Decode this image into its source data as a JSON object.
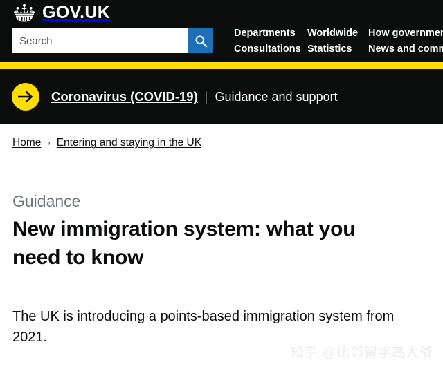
{
  "header": {
    "crown_icon": "royal-crown-icon",
    "brand": "GOV.UK",
    "search": {
      "placeholder": "Search",
      "value": "",
      "button_icon": "search-icon",
      "button_label": "Search",
      "button_color": "#1d70b8"
    },
    "nav": [
      "Departments",
      "Worldwide",
      "How government works",
      "Consultations",
      "Statistics",
      "News and communications"
    ],
    "background_color": "#0b0c0c",
    "accent_color": "#ffdd00"
  },
  "covid_banner": {
    "arrow_icon": "arrow-right-circle-icon",
    "link_text": "Coronavirus (COVID-19)",
    "separator": "|",
    "subtitle": "Guidance and support"
  },
  "breadcrumbs": {
    "separator": "›",
    "items": [
      "Home",
      "Entering and staying in the UK"
    ]
  },
  "main": {
    "document_type": "Guidance",
    "title": "New immigration system: what you need to know",
    "lead": "The UK is introducing a points-based immigration system from 2021."
  },
  "watermark": {
    "text": "知乎 @比邻留学高大爷"
  }
}
